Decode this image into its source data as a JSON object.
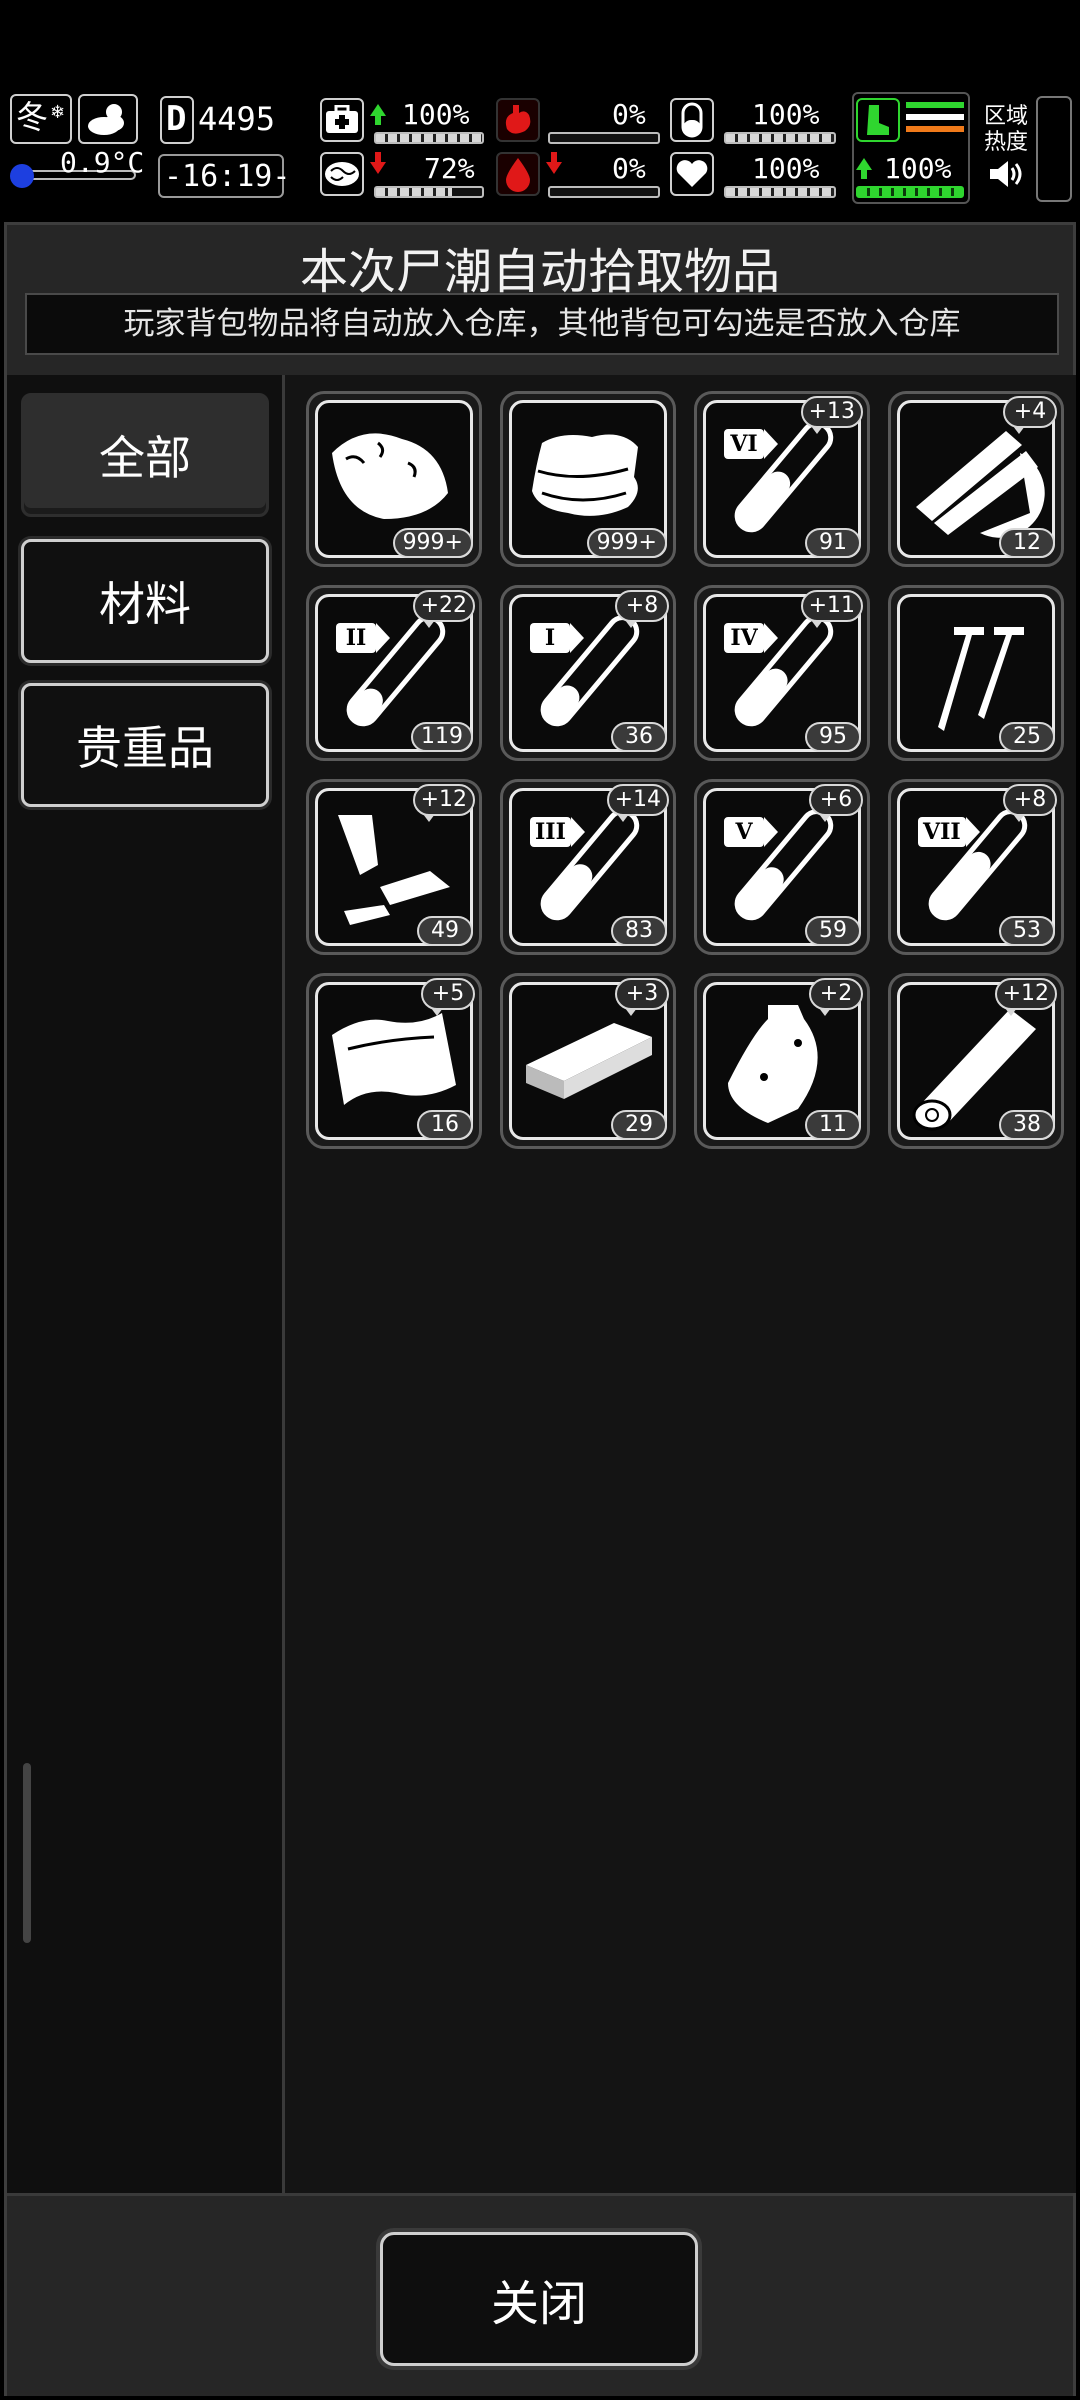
{
  "hud": {
    "season": "冬",
    "temperature": "0.9°C",
    "day": "4495",
    "time": "-16:19-",
    "health": "100%",
    "hunger": "0%",
    "pill": "100%",
    "brain": "72%",
    "blood": "0%",
    "heart": "100%",
    "stamina": "100%",
    "zone_heat_label": "区域\n热度"
  },
  "panel": {
    "title": "本次尸潮自动拾取物品",
    "notice": "玩家背包物品将自动放入仓库，其他背包可勾选是否放入仓库"
  },
  "sidebar": {
    "items": [
      {
        "label": "全部",
        "active": true
      },
      {
        "label": "材料",
        "active": false
      },
      {
        "label": "贵重品",
        "active": false
      }
    ]
  },
  "items": [
    {
      "icon": "raw-meat-icon",
      "count": "999+",
      "plus": ""
    },
    {
      "icon": "cloth-icon",
      "count": "999+",
      "plus": ""
    },
    {
      "icon": "test-tube-icon",
      "tag": "VI",
      "count": "91",
      "plus": "+13"
    },
    {
      "icon": "wood-planks-icon",
      "count": "12",
      "plus": "+4"
    },
    {
      "icon": "test-tube-icon",
      "tag": "II",
      "count": "119",
      "plus": "+22"
    },
    {
      "icon": "test-tube-icon",
      "tag": "I",
      "count": "36",
      "plus": "+8"
    },
    {
      "icon": "test-tube-icon",
      "tag": "IV",
      "count": "95",
      "plus": "+11"
    },
    {
      "icon": "screws-icon",
      "count": "25",
      "plus": ""
    },
    {
      "icon": "scrap-metal-icon",
      "count": "49",
      "plus": "+12"
    },
    {
      "icon": "test-tube-icon",
      "tag": "III",
      "count": "83",
      "plus": "+14"
    },
    {
      "icon": "test-tube-icon",
      "tag": "V",
      "count": "59",
      "plus": "+6"
    },
    {
      "icon": "test-tube-icon",
      "tag": "VII",
      "count": "53",
      "plus": "+8"
    },
    {
      "icon": "fabric-sheet-icon",
      "count": "16",
      "plus": "+5"
    },
    {
      "icon": "board-icon",
      "count": "29",
      "plus": "+3"
    },
    {
      "icon": "pouch-icon",
      "count": "11",
      "plus": "+2"
    },
    {
      "icon": "log-icon",
      "count": "38",
      "plus": "+12"
    }
  ],
  "footer": {
    "close_label": "关闭"
  },
  "colors": {
    "accent_green": "#2fd62f",
    "accent_red": "#e01818",
    "accent_orange": "#f07a1a"
  }
}
